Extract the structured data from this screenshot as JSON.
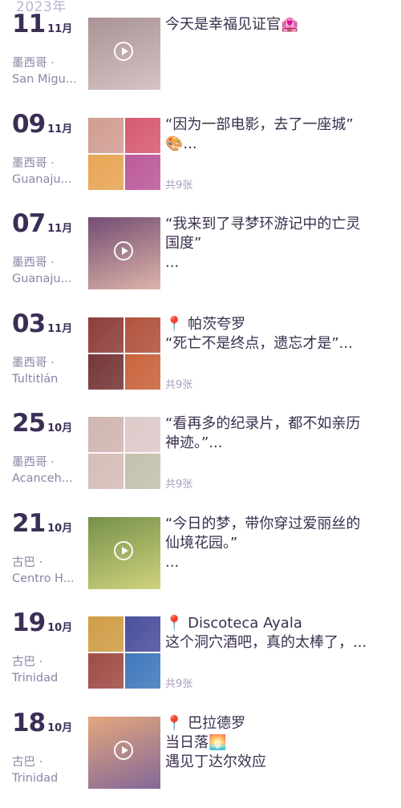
{
  "year_header": "2023年",
  "entries": [
    {
      "day": "11",
      "month": "11月",
      "loc_country": "墨西哥 ·",
      "loc_city": "San Migu...",
      "lines": [
        "今天是幸福见证官🏩"
      ],
      "count": "",
      "video": true,
      "thumb_colors": [
        "#9a8d86",
        "#cfc6bd"
      ]
    },
    {
      "day": "09",
      "month": "11月",
      "loc_country": "墨西哥 ·",
      "loc_city": "Guanaju...",
      "lines": [
        "“因为一部电影，去了一座城”",
        "🎨..."
      ],
      "count": "共9张",
      "video": false,
      "thumb_colors": [
        "#c99a83",
        "#d04c5a",
        "#e3a43a",
        "#b04a8c"
      ]
    },
    {
      "day": "07",
      "month": "11月",
      "loc_country": "墨西哥 ·",
      "loc_city": "Guanaju...",
      "lines": [
        "“我来到了寻梦环游记中的亡灵",
        "国度”",
        "..."
      ],
      "count": "",
      "video": true,
      "thumb_colors": [
        "#5b3a5e",
        "#d8b59e"
      ]
    },
    {
      "day": "03",
      "month": "11月",
      "loc_country": "墨西哥 ·",
      "loc_city": "Tultitlán",
      "lines": [
        "📍 帕茨夸罗",
        "“死亡不是终点，遗忘才是”..."
      ],
      "count": "共9张",
      "video": false,
      "thumb_colors": [
        "#7a2a1c",
        "#a3421f",
        "#5e2118",
        "#c0561f"
      ]
    },
    {
      "day": "25",
      "month": "10月",
      "loc_country": "墨西哥 ·",
      "loc_city": "Acanceh...",
      "lines": [
        "“看再多的纪录片，都不如亲历",
        "神迹。”..."
      ],
      "count": "共9张",
      "video": false,
      "thumb_colors": [
        "#c8b6a7",
        "#d8cfc4",
        "#cdbfae",
        "#b8c4a2"
      ]
    },
    {
      "day": "21",
      "month": "10月",
      "loc_country": "古巴 ·",
      "loc_city": "Centro H...",
      "lines": [
        "“今日的梦，带你穿过爱丽丝的",
        "仙境花园。”",
        "..."
      ],
      "count": "",
      "video": true,
      "thumb_colors": [
        "#5f8b2f",
        "#c7d86a"
      ]
    },
    {
      "day": "19",
      "month": "10月",
      "loc_country": "古巴 ·",
      "loc_city": "Trinidad",
      "lines": [
        "📍 Discoteca Ayala",
        "这个洞穴酒吧，真的太棒了，..."
      ],
      "count": "共9张",
      "video": false,
      "thumb_colors": [
        "#c79a2a",
        "#2b3f8f",
        "#8f3a2a",
        "#1f6fb5"
      ]
    },
    {
      "day": "18",
      "month": "10月",
      "loc_country": "古巴 ·",
      "loc_city": "Trinidad",
      "lines": [
        "📍 巴拉德罗",
        "当日落🌅",
        "遇见丁达尔效应"
      ],
      "count": "",
      "video": true,
      "thumb_colors": [
        "#e0a56a",
        "#6d5a8a"
      ]
    }
  ]
}
